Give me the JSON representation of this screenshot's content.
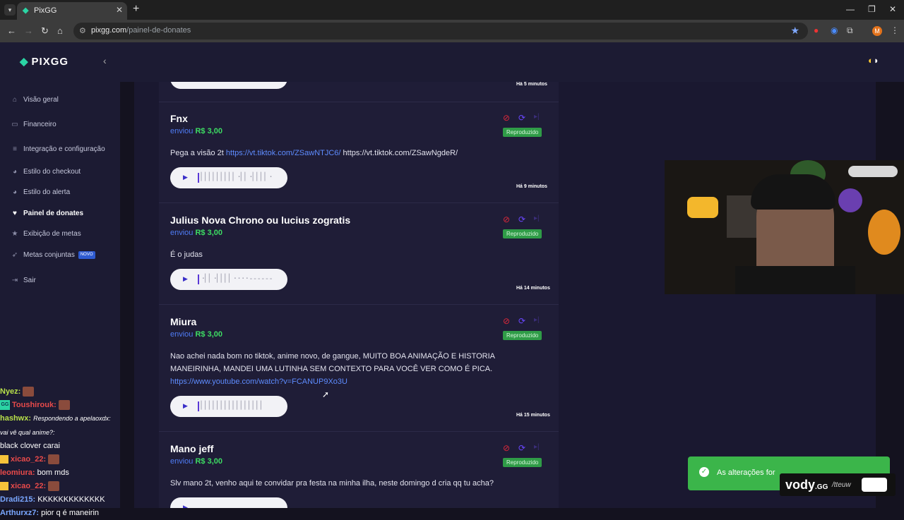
{
  "browser": {
    "tab_title": "PixGG",
    "url_host": "pixgg.com",
    "url_path": "/painel-de-donates"
  },
  "sidebar": {
    "brand": "PIXGG",
    "items": [
      {
        "label": "Visão geral",
        "icon": "home-icon"
      },
      {
        "label": "Financeiro",
        "icon": "wallet-icon"
      },
      {
        "label": "Integração e configuração",
        "icon": "settings-doc-icon"
      },
      {
        "label": "Estilo do checkout",
        "icon": "palette-icon"
      },
      {
        "label": "Estilo do alerta",
        "icon": "palette-icon"
      },
      {
        "label": "Painel de donates",
        "icon": "hand-heart-icon"
      },
      {
        "label": "Exibição de metas",
        "icon": "star-icon"
      },
      {
        "label": "Metas conjuntas",
        "icon": "rocket-icon",
        "badge": "NOVO"
      },
      {
        "label": "Sair",
        "icon": "logout-icon"
      }
    ]
  },
  "feed": {
    "top_time": "Há 5 minutos",
    "donations": [
      {
        "name": "Fnx",
        "sent_prefix": "enviou",
        "amount": "R$ 3,00",
        "status": "Reproduzido",
        "message_text": "Pega a visão 2t ",
        "message_link": "https://vt.tiktok.com/ZSawNTJC6/",
        "message_suffix": " https://vt.tiktok.com/ZSawNgdeR/",
        "time": "Há 9 minutos"
      },
      {
        "name": "Julius Nova Chrono ou lucius zogratis",
        "sent_prefix": "enviou",
        "amount": "R$ 3,00",
        "status": "Reproduzido",
        "message_text": "É o judas",
        "time": "Há 14 minutos"
      },
      {
        "name": "Miura",
        "sent_prefix": "enviou",
        "amount": "R$ 3,00",
        "status": "Reproduzido",
        "message_text": "Nao achei nada bom no tiktok, anime novo, de gangue, MUITO BOA ANIMAÇÃO E HISTORIA MANEIRINHA, MANDEI UMA LUTINHA SEM CONTEXTO PARA VOCÊ VER COMO É PICA.",
        "message_link": "https://www.youtube.com/watch?v=FCANUP9Xo3U",
        "time": "Há 15 minutos"
      },
      {
        "name": "Mano jeff",
        "sent_prefix": "enviou",
        "amount": "R$ 3,00",
        "status": "Reproduzido",
        "message_text": "Slv mano 2t, venho aqui te convidar pra festa na minha ilha, neste domingo d cria qq tu acha?"
      }
    ]
  },
  "chat": [
    {
      "user": "Nyez:",
      "text": "",
      "color": "#b8e04a"
    },
    {
      "user": "Toushirouk:",
      "text": "",
      "color": "#e84a4a"
    },
    {
      "user": "hashwx:",
      "reply": "Respondendo a apelaoxdx: vai vê qual anime?:",
      "text": "black clover carai",
      "color": "#b8e04a"
    },
    {
      "user": "xicao_22:",
      "text": "",
      "color": "#e84a4a"
    },
    {
      "user": "leomiura:",
      "text": "bom mds",
      "color": "#e84a4a"
    },
    {
      "user": "xicao_22:",
      "text": "",
      "color": "#e84a4a"
    },
    {
      "user": "Dradi215:",
      "text": "KKKKKKKKKKKKK",
      "color": "#7aa7ff"
    },
    {
      "user": "Arthurxz7:",
      "text": "pior q é maneirin",
      "color": "#7aa7ff"
    }
  ],
  "toast": {
    "text": "As alterações for"
  },
  "overlay": {
    "brand": "vody",
    "brand_suffix": ".GG",
    "handle": "/tteuw"
  }
}
